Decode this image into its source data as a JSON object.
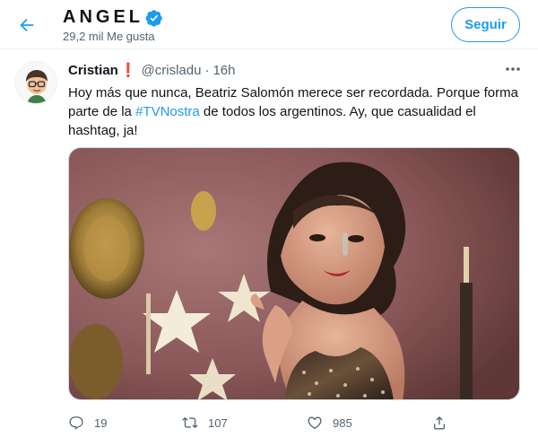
{
  "header": {
    "back_icon": "arrow-left-icon",
    "name": "ANGEL",
    "verified_icon": "verified-badge-icon",
    "likes_text": "29,2 mil Me gusta",
    "follow_label": "Seguir"
  },
  "tweet": {
    "author": "Cristian",
    "author_emoji": "❗",
    "handle": "@crisladu",
    "separator": "·",
    "time": "16h",
    "more_icon": "more-icon",
    "text_before": "Hoy más que nunca, Beatriz Salomón merece ser recordada. Porque forma parte de la ",
    "hashtag": "#TVNostra",
    "text_after": " de todos los argentinos. Ay, que casualidad el hashtag, ja!",
    "media_description_icon": "photo",
    "actions": {
      "reply_count": "19",
      "retweet_count": "107",
      "like_count": "985",
      "reply_icon": "reply-icon",
      "retweet_icon": "retweet-icon",
      "like_icon": "heart-icon",
      "share_icon": "share-icon"
    }
  },
  "colors": {
    "accent": "#1d9bf0",
    "secondary_text": "#536471",
    "border": "#eff3f4"
  }
}
